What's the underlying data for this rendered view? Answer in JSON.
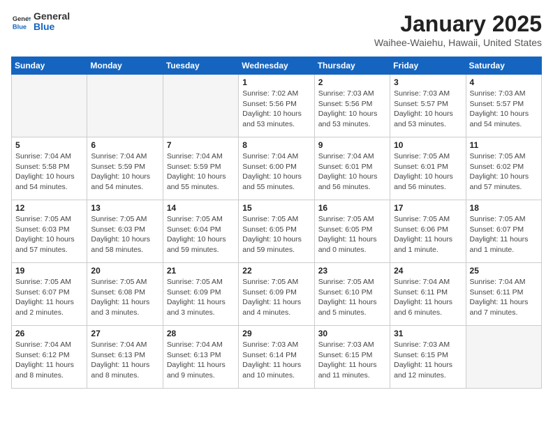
{
  "header": {
    "logo_line1": "General",
    "logo_line2": "Blue",
    "title": "January 2025",
    "subtitle": "Waihee-Waiehu, Hawaii, United States"
  },
  "weekdays": [
    "Sunday",
    "Monday",
    "Tuesday",
    "Wednesday",
    "Thursday",
    "Friday",
    "Saturday"
  ],
  "weeks": [
    [
      {
        "day": "",
        "info": ""
      },
      {
        "day": "",
        "info": ""
      },
      {
        "day": "",
        "info": ""
      },
      {
        "day": "1",
        "info": "Sunrise: 7:02 AM\nSunset: 5:56 PM\nDaylight: 10 hours\nand 53 minutes."
      },
      {
        "day": "2",
        "info": "Sunrise: 7:03 AM\nSunset: 5:56 PM\nDaylight: 10 hours\nand 53 minutes."
      },
      {
        "day": "3",
        "info": "Sunrise: 7:03 AM\nSunset: 5:57 PM\nDaylight: 10 hours\nand 53 minutes."
      },
      {
        "day": "4",
        "info": "Sunrise: 7:03 AM\nSunset: 5:57 PM\nDaylight: 10 hours\nand 54 minutes."
      }
    ],
    [
      {
        "day": "5",
        "info": "Sunrise: 7:04 AM\nSunset: 5:58 PM\nDaylight: 10 hours\nand 54 minutes."
      },
      {
        "day": "6",
        "info": "Sunrise: 7:04 AM\nSunset: 5:59 PM\nDaylight: 10 hours\nand 54 minutes."
      },
      {
        "day": "7",
        "info": "Sunrise: 7:04 AM\nSunset: 5:59 PM\nDaylight: 10 hours\nand 55 minutes."
      },
      {
        "day": "8",
        "info": "Sunrise: 7:04 AM\nSunset: 6:00 PM\nDaylight: 10 hours\nand 55 minutes."
      },
      {
        "day": "9",
        "info": "Sunrise: 7:04 AM\nSunset: 6:01 PM\nDaylight: 10 hours\nand 56 minutes."
      },
      {
        "day": "10",
        "info": "Sunrise: 7:05 AM\nSunset: 6:01 PM\nDaylight: 10 hours\nand 56 minutes."
      },
      {
        "day": "11",
        "info": "Sunrise: 7:05 AM\nSunset: 6:02 PM\nDaylight: 10 hours\nand 57 minutes."
      }
    ],
    [
      {
        "day": "12",
        "info": "Sunrise: 7:05 AM\nSunset: 6:03 PM\nDaylight: 10 hours\nand 57 minutes."
      },
      {
        "day": "13",
        "info": "Sunrise: 7:05 AM\nSunset: 6:03 PM\nDaylight: 10 hours\nand 58 minutes."
      },
      {
        "day": "14",
        "info": "Sunrise: 7:05 AM\nSunset: 6:04 PM\nDaylight: 10 hours\nand 59 minutes."
      },
      {
        "day": "15",
        "info": "Sunrise: 7:05 AM\nSunset: 6:05 PM\nDaylight: 10 hours\nand 59 minutes."
      },
      {
        "day": "16",
        "info": "Sunrise: 7:05 AM\nSunset: 6:05 PM\nDaylight: 11 hours\nand 0 minutes."
      },
      {
        "day": "17",
        "info": "Sunrise: 7:05 AM\nSunset: 6:06 PM\nDaylight: 11 hours\nand 1 minute."
      },
      {
        "day": "18",
        "info": "Sunrise: 7:05 AM\nSunset: 6:07 PM\nDaylight: 11 hours\nand 1 minute."
      }
    ],
    [
      {
        "day": "19",
        "info": "Sunrise: 7:05 AM\nSunset: 6:07 PM\nDaylight: 11 hours\nand 2 minutes."
      },
      {
        "day": "20",
        "info": "Sunrise: 7:05 AM\nSunset: 6:08 PM\nDaylight: 11 hours\nand 3 minutes."
      },
      {
        "day": "21",
        "info": "Sunrise: 7:05 AM\nSunset: 6:09 PM\nDaylight: 11 hours\nand 3 minutes."
      },
      {
        "day": "22",
        "info": "Sunrise: 7:05 AM\nSunset: 6:09 PM\nDaylight: 11 hours\nand 4 minutes."
      },
      {
        "day": "23",
        "info": "Sunrise: 7:05 AM\nSunset: 6:10 PM\nDaylight: 11 hours\nand 5 minutes."
      },
      {
        "day": "24",
        "info": "Sunrise: 7:04 AM\nSunset: 6:11 PM\nDaylight: 11 hours\nand 6 minutes."
      },
      {
        "day": "25",
        "info": "Sunrise: 7:04 AM\nSunset: 6:11 PM\nDaylight: 11 hours\nand 7 minutes."
      }
    ],
    [
      {
        "day": "26",
        "info": "Sunrise: 7:04 AM\nSunset: 6:12 PM\nDaylight: 11 hours\nand 8 minutes."
      },
      {
        "day": "27",
        "info": "Sunrise: 7:04 AM\nSunset: 6:13 PM\nDaylight: 11 hours\nand 8 minutes."
      },
      {
        "day": "28",
        "info": "Sunrise: 7:04 AM\nSunset: 6:13 PM\nDaylight: 11 hours\nand 9 minutes."
      },
      {
        "day": "29",
        "info": "Sunrise: 7:03 AM\nSunset: 6:14 PM\nDaylight: 11 hours\nand 10 minutes."
      },
      {
        "day": "30",
        "info": "Sunrise: 7:03 AM\nSunset: 6:15 PM\nDaylight: 11 hours\nand 11 minutes."
      },
      {
        "day": "31",
        "info": "Sunrise: 7:03 AM\nSunset: 6:15 PM\nDaylight: 11 hours\nand 12 minutes."
      },
      {
        "day": "",
        "info": ""
      }
    ]
  ]
}
